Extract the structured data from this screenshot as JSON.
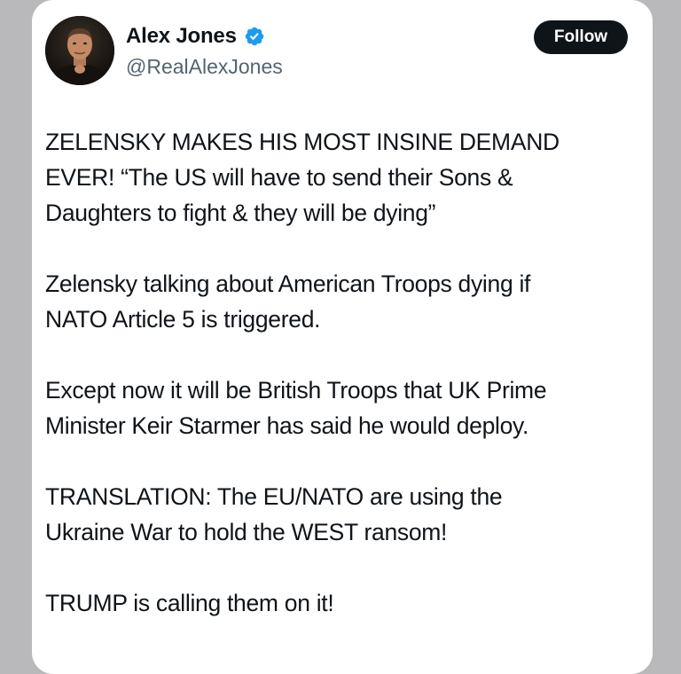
{
  "post": {
    "author": {
      "display_name": "Alex Jones",
      "handle": "@RealAlexJones",
      "verified": true,
      "verified_color": "#1d9bf0"
    },
    "follow_label": "Follow",
    "paragraphs": [
      {
        "lines": [
          "ZELENSKY MAKES HIS MOST INSINE DEMAND",
          "EVER! “The US will have to send their Sons &",
          "Daughters to fight & they will be dying”"
        ]
      },
      {
        "lines": [
          "Zelensky talking about American Troops dying if",
          "NATO Article 5 is triggered."
        ]
      },
      {
        "lines": [
          "Except now it will be British Troops that UK Prime",
          "Minister Keir Starmer has said he would deploy."
        ]
      },
      {
        "lines": [
          "TRANSLATION: The EU/NATO are using the",
          "Ukraine War to hold the WEST ransom!"
        ]
      },
      {
        "lines": [
          "TRUMP is calling them on it!"
        ]
      }
    ]
  },
  "colors": {
    "background": "#b9b9bc",
    "card": "#ffffff",
    "text": "#0f1419",
    "secondary_text": "#536471",
    "button": "#0f1419"
  }
}
